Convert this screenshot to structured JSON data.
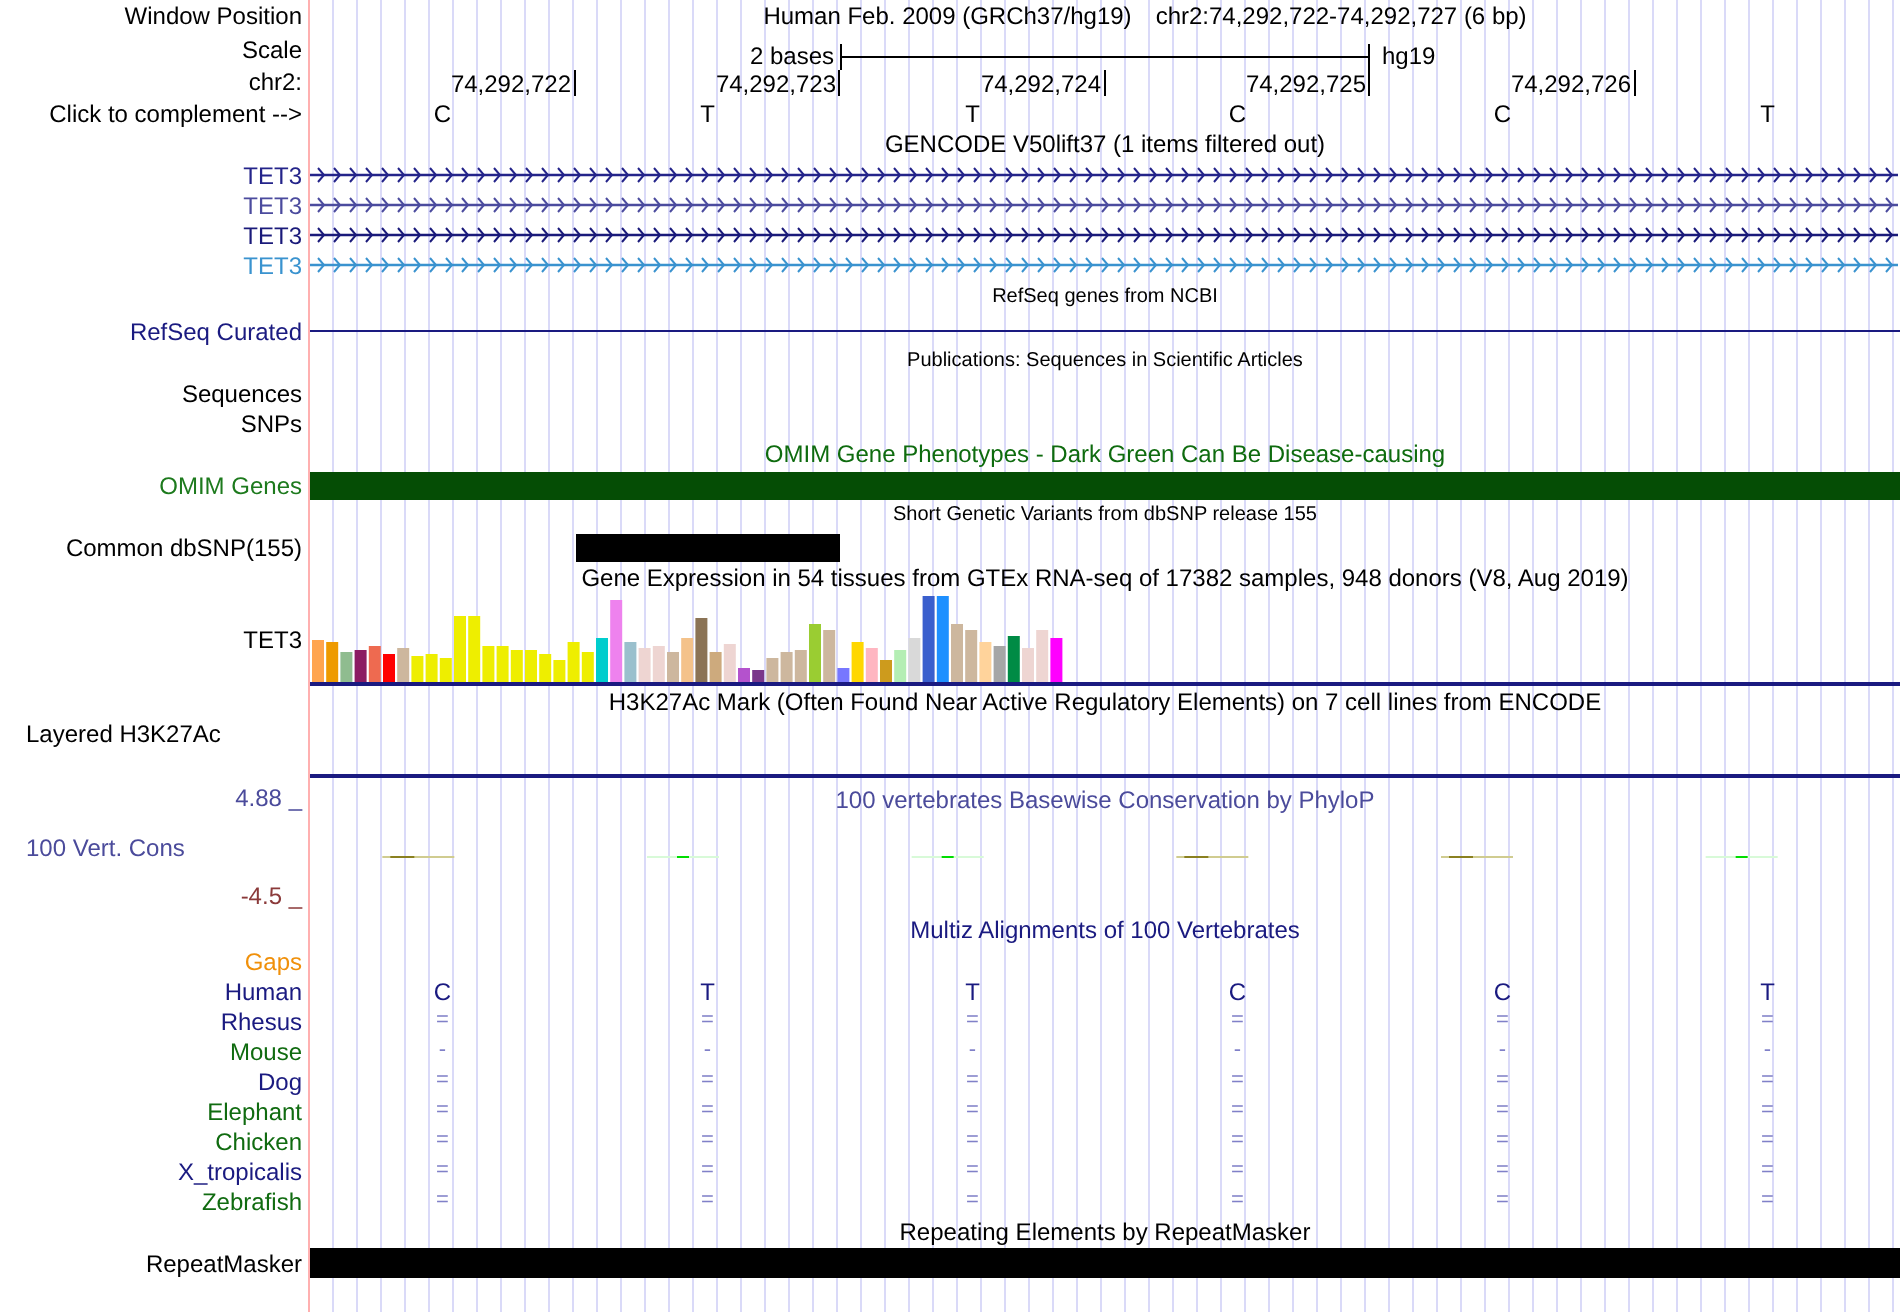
{
  "header": {
    "label": "Window Position",
    "assembly": "Human Feb. 2009 (GRCh37/hg19)",
    "position": "chr2:74,292,722-74,292,727 (6 bp)"
  },
  "scale": {
    "label": "Scale",
    "span": "2 bases",
    "assembly": "hg19"
  },
  "ruler": {
    "label": "chr2:",
    "ticks": [
      "74,292,722",
      "74,292,723",
      "74,292,724",
      "74,292,725",
      "74,292,726"
    ]
  },
  "sequence": {
    "label": "Click to complement -->",
    "bases": [
      "C",
      "T",
      "T",
      "C",
      "C",
      "T"
    ]
  },
  "gencode": {
    "title": "GENCODE V50lift37 (1 items filtered out)",
    "genes": [
      {
        "name": "TET3",
        "color": "#24248a"
      },
      {
        "name": "TET3",
        "color": "#4b4b9e"
      },
      {
        "name": "TET3",
        "color": "#1a1a7a"
      },
      {
        "name": "TET3",
        "color": "#3a93cf"
      }
    ]
  },
  "refseq": {
    "title": "RefSeq genes from NCBI",
    "label": "RefSeq Curated"
  },
  "publications": {
    "title": "Publications: Sequences in Scientific Articles",
    "labels": [
      "Sequences",
      "SNPs"
    ]
  },
  "omim": {
    "title": "OMIM Gene Phenotypes - Dark Green Can Be Disease-causing",
    "label": "OMIM Genes"
  },
  "dbsnp": {
    "title": "Short Genetic Variants from dbSNP release 155",
    "label": "Common dbSNP(155)"
  },
  "gtex": {
    "title": "Gene Expression in 54 tissues from GTEx RNA-seq of 17382 samples, 948 donors (V8, Aug 2019)",
    "label": "TET3"
  },
  "h3k27ac": {
    "title": "H3K27Ac Mark (Often Found Near Active Regulatory Elements) on 7 cell lines from ENCODE",
    "label": "Layered H3K27Ac"
  },
  "phylop": {
    "title": "100 vertebrates Basewise Conservation by PhyloP",
    "label": "100 Vert. Cons",
    "max": "4.88 _",
    "min": "-4.5 _"
  },
  "multiz": {
    "title": "Multiz Alignments of 100 Vertebrates",
    "gaps_label": "Gaps",
    "species": [
      {
        "name": "Human",
        "color": "#1a1a80",
        "bases": [
          "C",
          "T",
          "T",
          "C",
          "C",
          "T"
        ]
      },
      {
        "name": "Rhesus",
        "color": "#1a1a80",
        "bases": [
          "=",
          "=",
          "=",
          "=",
          "=",
          "="
        ]
      },
      {
        "name": "Mouse",
        "color": "#106b10",
        "bases": [
          "-",
          "-",
          "-",
          "-",
          "-",
          "-"
        ]
      },
      {
        "name": "Dog",
        "color": "#1a1a80",
        "bases": [
          "=",
          "=",
          "=",
          "=",
          "=",
          "="
        ]
      },
      {
        "name": "Elephant",
        "color": "#106b10",
        "bases": [
          "=",
          "=",
          "=",
          "=",
          "=",
          "="
        ]
      },
      {
        "name": "Chicken",
        "color": "#106b10",
        "bases": [
          "=",
          "=",
          "=",
          "=",
          "=",
          "="
        ]
      },
      {
        "name": "X_tropicalis",
        "color": "#1a1a80",
        "bases": [
          "=",
          "=",
          "=",
          "=",
          "=",
          "="
        ]
      },
      {
        "name": "Zebrafish",
        "color": "#106b10",
        "bases": [
          "=",
          "=",
          "=",
          "=",
          "=",
          "="
        ]
      }
    ]
  },
  "repeatmasker": {
    "title": "Repeating Elements by RepeatMasker",
    "label": "RepeatMasker"
  }
}
